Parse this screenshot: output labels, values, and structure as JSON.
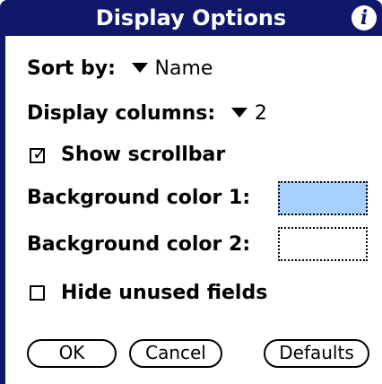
{
  "title": "Display Options",
  "info_icon": "info-icon",
  "sort": {
    "label": "Sort by:",
    "value": "Name"
  },
  "columns": {
    "label": "Display columns:",
    "value": "2"
  },
  "show_scrollbar": {
    "label": "Show scrollbar",
    "checked": true
  },
  "bg1": {
    "label": "Background color 1:",
    "color": "#a8d0ff"
  },
  "bg2": {
    "label": "Background color 2:",
    "color": "#ffffff"
  },
  "hide_unused": {
    "label": "Hide unused fields",
    "checked": false
  },
  "buttons": {
    "ok": "OK",
    "cancel": "Cancel",
    "defaults": "Defaults"
  },
  "colors": {
    "titlebar": "#10186b",
    "swatch1": "#a8d0ff"
  }
}
